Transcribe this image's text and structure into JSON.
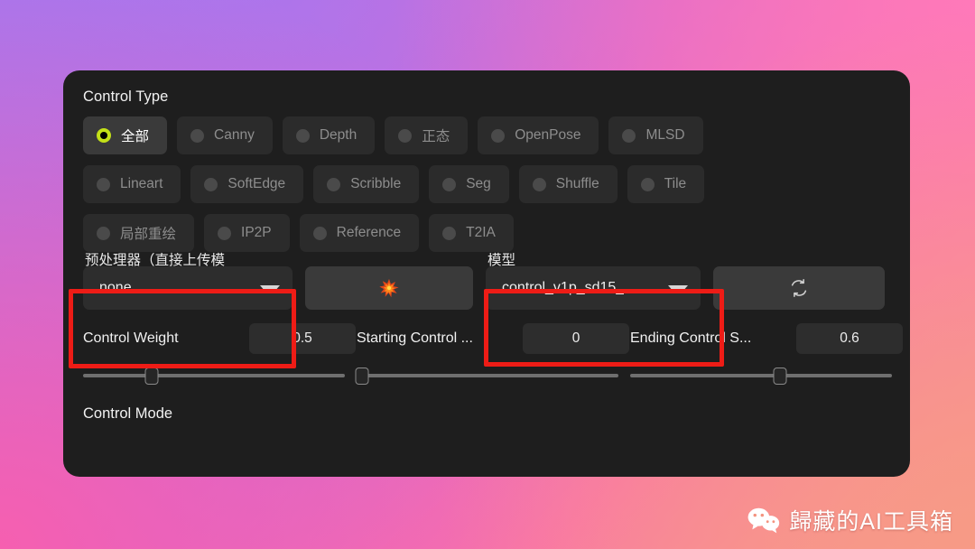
{
  "panel": {
    "control_type_title": "Control Type",
    "control_mode_title": "Control Mode"
  },
  "control_types": {
    "rows": [
      [
        {
          "label": "全部",
          "selected": true
        },
        {
          "label": "Canny",
          "selected": false
        },
        {
          "label": "Depth",
          "selected": false
        },
        {
          "label": "正态",
          "selected": false
        },
        {
          "label": "OpenPose",
          "selected": false
        },
        {
          "label": "MLSD",
          "selected": false
        }
      ],
      [
        {
          "label": "Lineart",
          "selected": false
        },
        {
          "label": "SoftEdge",
          "selected": false
        },
        {
          "label": "Scribble",
          "selected": false
        },
        {
          "label": "Seg",
          "selected": false
        },
        {
          "label": "Shuffle",
          "selected": false
        },
        {
          "label": "Tile",
          "selected": false
        }
      ],
      [
        {
          "label": "局部重绘",
          "selected": false
        },
        {
          "label": "IP2P",
          "selected": false
        },
        {
          "label": "Reference",
          "selected": false
        },
        {
          "label": "T2IA",
          "selected": false
        }
      ]
    ]
  },
  "preprocessor": {
    "label": "预处理器（直接上传模",
    "value": "none",
    "run_icon": "explosion-icon"
  },
  "model": {
    "label": "模型",
    "value": "control_v1p_sd15_",
    "refresh_icon": "refresh-icon"
  },
  "sliders": [
    {
      "name": "Control Weight",
      "value": "0.5",
      "percent": 25
    },
    {
      "name": "Starting Control ...",
      "value": "0",
      "percent": 2
    },
    {
      "name": "Ending Control S...",
      "value": "0.6",
      "percent": 55
    }
  ],
  "annotations": {
    "accent_color": "#ee1c16",
    "boxes": [
      "preprocessor-dropdown",
      "model-dropdown"
    ]
  },
  "watermark": {
    "text": "歸藏的AI工具箱",
    "icon": "wechat-icon"
  },
  "colors": {
    "panel_bg": "#1e1e1e",
    "chip_bg": "#2b2b2b",
    "chip_selected_bg": "#3a3a3a",
    "radio_active": "#c3e018",
    "annotation_red": "#ee1c16"
  }
}
